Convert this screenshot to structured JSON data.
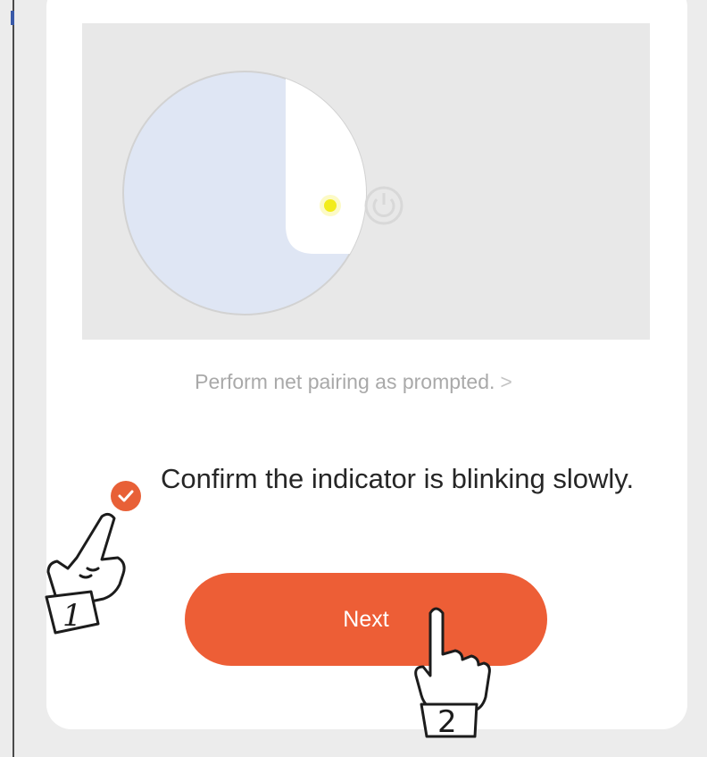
{
  "illustration": {
    "indicator_color": "#f2ec1c",
    "icon": "power-icon"
  },
  "instruction": {
    "text": "Perform net pairing as prompted.",
    "chevron": ">"
  },
  "confirm": {
    "checked": true,
    "text": "Confirm the indicator is blinking slowly."
  },
  "next_button": {
    "label": "Next"
  },
  "annotations": {
    "step1": "1",
    "step2": "2"
  },
  "colors": {
    "accent": "#ed5e36"
  }
}
